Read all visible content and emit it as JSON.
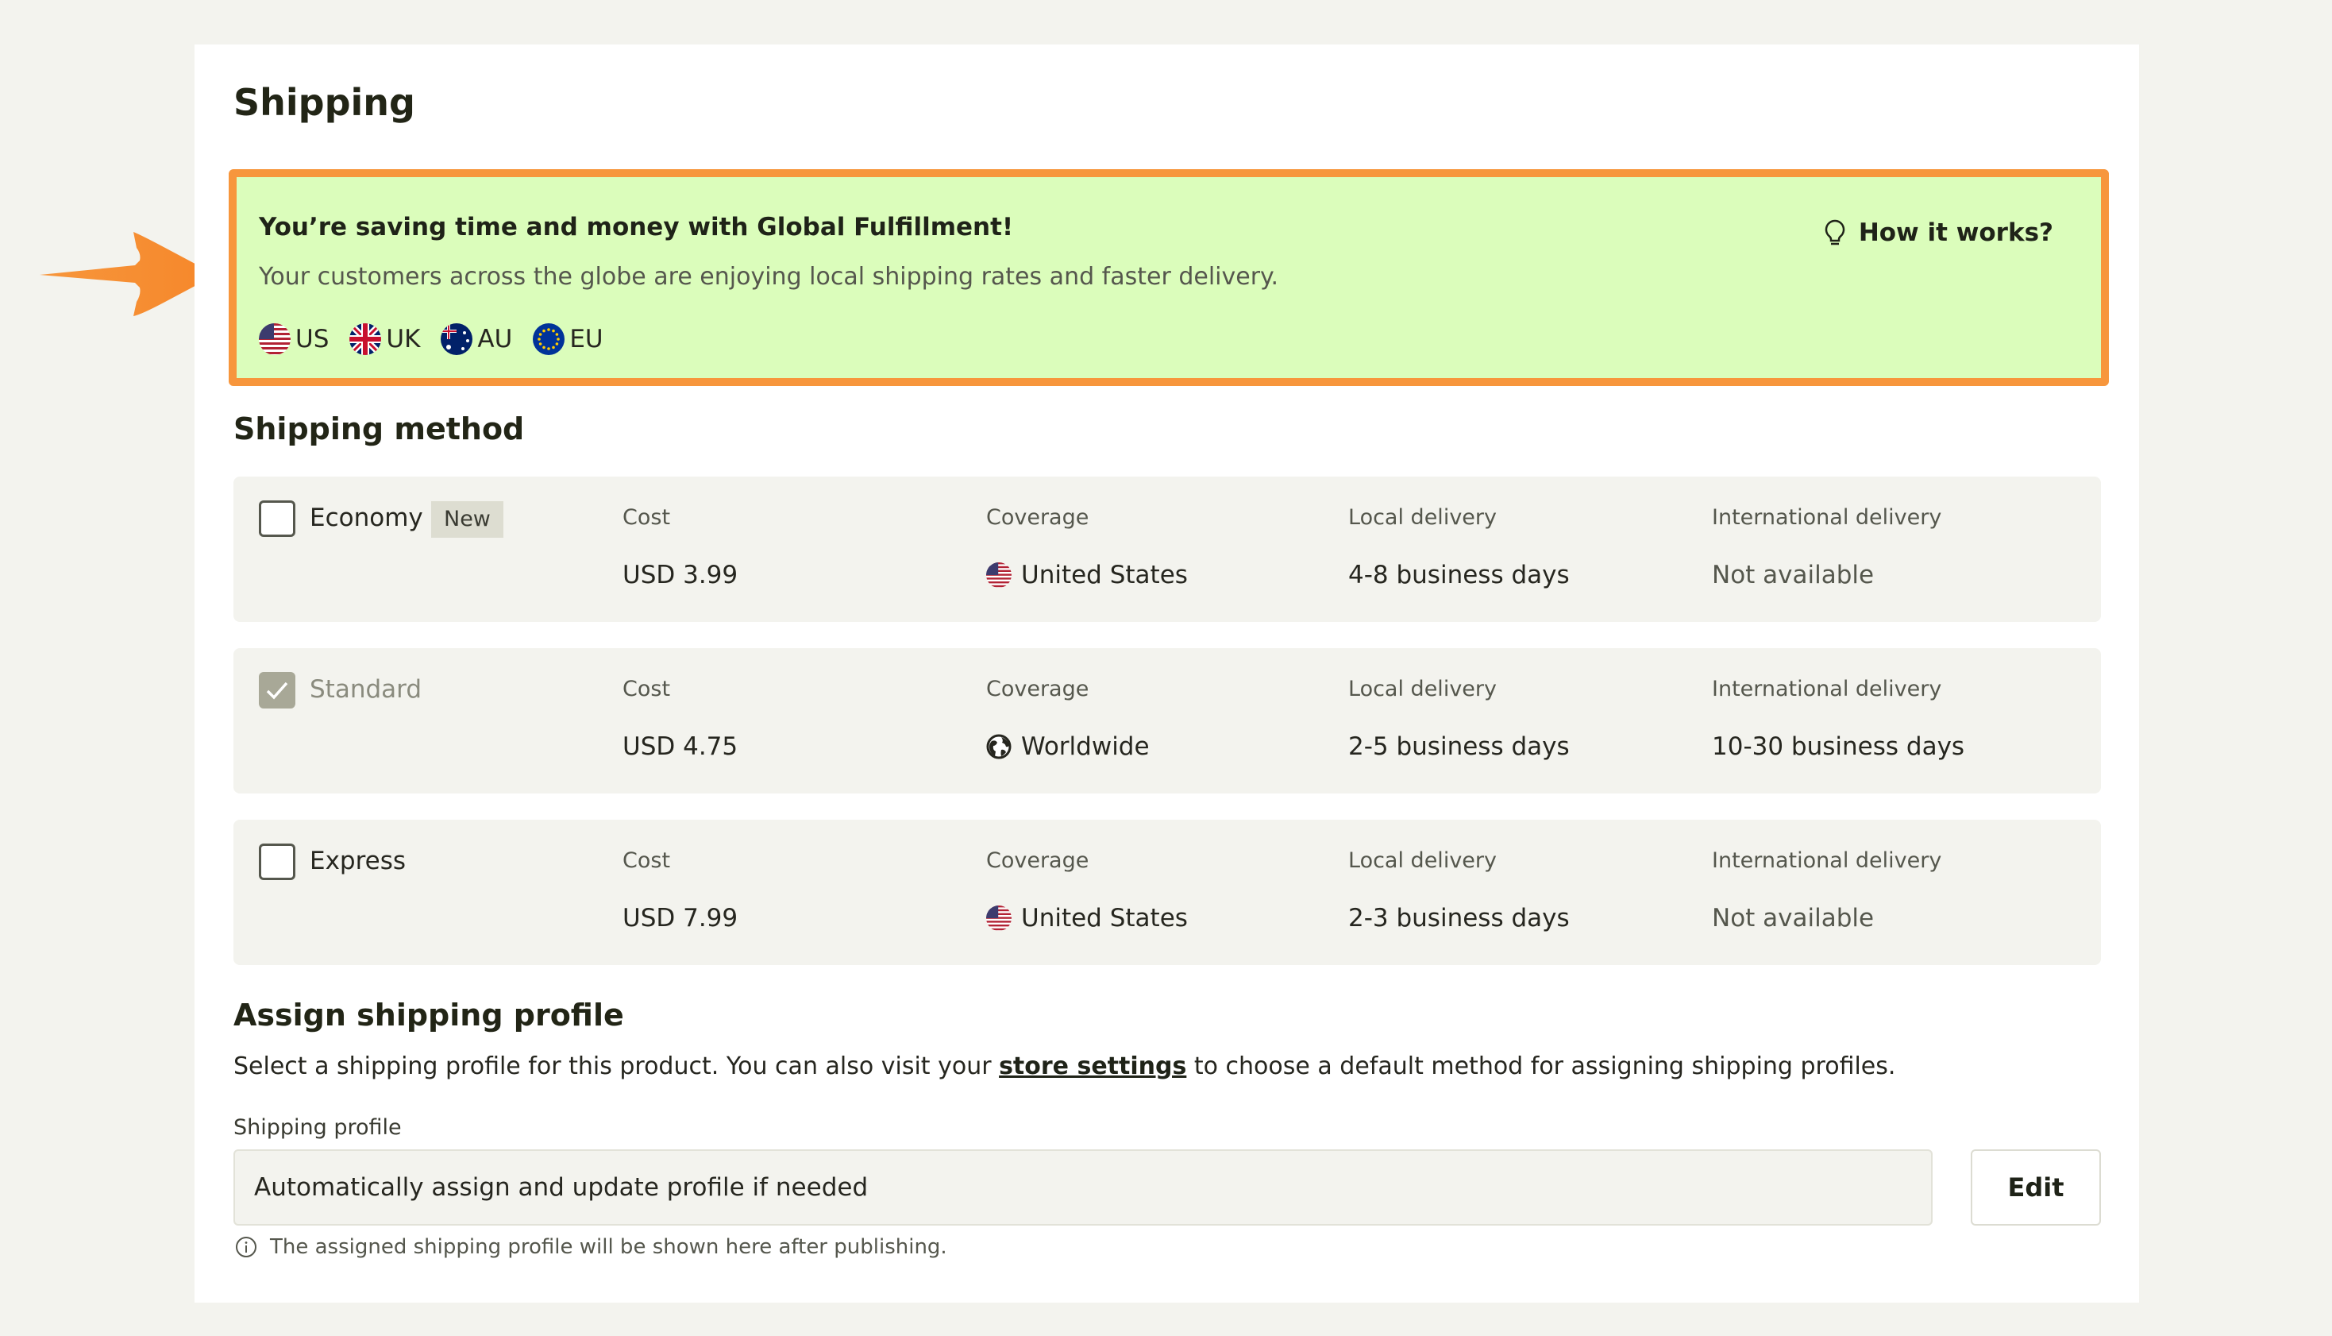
{
  "page": {
    "title": "Shipping"
  },
  "banner": {
    "title": "You’re saving time and money with Global Fulfillment!",
    "description": "Your customers across the globe are enjoying local shipping rates and faster delivery.",
    "how_it_works": "How it works?",
    "regions": [
      "US",
      "UK",
      "AU",
      "EU"
    ],
    "border_color": "#f7963c",
    "background_color": "#dbfdbb"
  },
  "shipping_method": {
    "title": "Shipping method",
    "columns": [
      "Cost",
      "Coverage",
      "Local delivery",
      "International delivery"
    ],
    "rows": [
      {
        "name": "Economy",
        "badge": "New",
        "checked": false,
        "cost": "USD 3.99",
        "coverage": "United States",
        "coverage_icon": "us-flag-icon",
        "local": "4-8 business days",
        "international": "Not available"
      },
      {
        "name": "Standard",
        "checked": true,
        "cost": "USD 4.75",
        "coverage": "Worldwide",
        "coverage_icon": "globe-icon",
        "local": "2-5 business days",
        "international": "10-30 business days"
      },
      {
        "name": "Express",
        "checked": false,
        "cost": "USD 7.99",
        "coverage": "United States",
        "coverage_icon": "us-flag-icon",
        "local": "2-3 business days",
        "international": "Not available"
      }
    ]
  },
  "profile": {
    "title": "Assign shipping profile",
    "desc_before": "Select a shipping profile for this product. You can also visit your ",
    "link": "store settings",
    "desc_after": " to choose a default method for assigning shipping profiles.",
    "field_label": "Shipping profile",
    "selected": "Automatically assign and update profile if needed",
    "edit": "Edit",
    "help": "The assigned shipping profile will be shown here after publishing."
  }
}
